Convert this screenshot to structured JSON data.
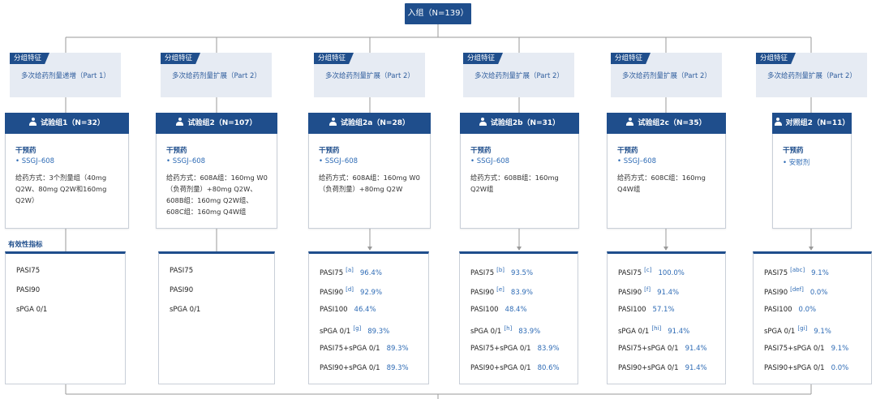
{
  "enrollment": "入组（N=139）",
  "feature_tag": "分组特征",
  "efficacy_label": "有效性指标",
  "drug_label": "干预药",
  "groups": [
    {
      "feature": "多次给药剂量递增（Part 1）",
      "name": "试验组1（N=32）",
      "drug": "• SSGJ–608",
      "dose": "给药方式：3个剂量组（40mg Q2W、80mg Q2W和160mg Q2W）",
      "metrics": [
        {
          "name": "PASI75",
          "note": "",
          "value": ""
        },
        {
          "name": "PASI90",
          "note": "",
          "value": ""
        },
        {
          "name": "sPGA 0/1",
          "note": "",
          "value": ""
        }
      ]
    },
    {
      "feature": "多次给药剂量扩展（Part 2）",
      "name": "试验组2（N=107）",
      "drug": "• SSGJ–608",
      "dose": "给药方式：608A组：160mg W0（负荷剂量）+80mg Q2W、608B组：160mg Q2W组、608C组：160mg Q4W组",
      "metrics": [
        {
          "name": "PASI75",
          "note": "",
          "value": ""
        },
        {
          "name": "PASI90",
          "note": "",
          "value": ""
        },
        {
          "name": "sPGA 0/1",
          "note": "",
          "value": ""
        }
      ]
    },
    {
      "feature": "多次给药剂量扩展（Part 2）",
      "name": "试验组2a（N=28）",
      "drug": "• SSGJ–608",
      "dose": "给药方式：608A组：160mg W0（负荷剂量）+80mg Q2W",
      "metrics": [
        {
          "name": "PASI75",
          "note": "[a]",
          "value": "96.4%"
        },
        {
          "name": "PASI90",
          "note": "[d]",
          "value": "92.9%"
        },
        {
          "name": "PASI100",
          "note": "",
          "value": "46.4%"
        },
        {
          "name": "sPGA 0/1",
          "note": "[g]",
          "value": "89.3%"
        },
        {
          "name": "PASI75+sPGA 0/1",
          "note": "",
          "value": "89.3%"
        },
        {
          "name": "PASI90+sPGA 0/1",
          "note": "",
          "value": "89.3%"
        }
      ]
    },
    {
      "feature": "多次给药剂量扩展（Part 2）",
      "name": "试验组2b（N=31）",
      "drug": "• SSGJ–608",
      "dose": "给药方式：608B组：160mg Q2W组",
      "metrics": [
        {
          "name": "PASI75",
          "note": "[b]",
          "value": "93.5%"
        },
        {
          "name": "PASI90",
          "note": "[e]",
          "value": "83.9%"
        },
        {
          "name": "PASI100",
          "note": "",
          "value": "48.4%"
        },
        {
          "name": "sPGA 0/1",
          "note": "[h]",
          "value": "83.9%"
        },
        {
          "name": "PASI75+sPGA 0/1",
          "note": "",
          "value": "83.9%"
        },
        {
          "name": "PASI90+sPGA 0/1",
          "note": "",
          "value": "80.6%"
        }
      ]
    },
    {
      "feature": "多次给药剂量扩展（Part 2）",
      "name": "试验组2c（N=35）",
      "drug": "• SSGJ–608",
      "dose": "给药方式：608C组：160mg Q4W组",
      "metrics": [
        {
          "name": "PASI75",
          "note": "[c]",
          "value": "100.0%"
        },
        {
          "name": "PASI90",
          "note": "[f]",
          "value": "91.4%"
        },
        {
          "name": "PASI100",
          "note": "",
          "value": "57.1%"
        },
        {
          "name": "sPGA 0/1",
          "note": "[hi]",
          "value": "91.4%"
        },
        {
          "name": "PASI75+sPGA 0/1",
          "note": "",
          "value": "91.4%"
        },
        {
          "name": "PASI90+sPGA 0/1",
          "note": "",
          "value": "91.4%"
        }
      ]
    },
    {
      "feature": "多次给药剂量扩展（Part 2）",
      "name": "对照组2（N=11）",
      "drug": "• 安慰剂",
      "dose": "",
      "metrics": [
        {
          "name": "PASI75",
          "note": "[abc]",
          "value": "9.1%"
        },
        {
          "name": "PASI90",
          "note": "[def]",
          "value": "0.0%"
        },
        {
          "name": "PASI100",
          "note": "",
          "value": "0.0%"
        },
        {
          "name": "sPGA 0/1",
          "note": "[gi]",
          "value": "9.1%"
        },
        {
          "name": "PASI75+sPGA 0/1",
          "note": "",
          "value": "9.1%"
        },
        {
          "name": "PASI90+sPGA 0/1",
          "note": "",
          "value": "0.0%"
        }
      ]
    }
  ]
}
